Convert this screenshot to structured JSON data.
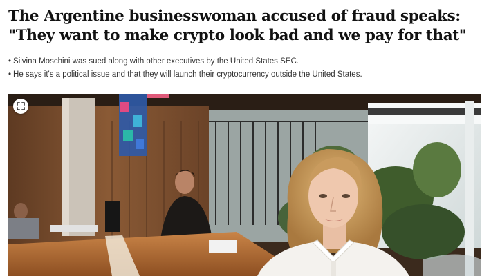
{
  "article": {
    "headline": "The Argentine businesswoman accused of fraud speaks: \"They want to make crypto look bad and we pay for that\"",
    "bullets": [
      "Silvina Moschini was sued along with other executives by the United States SEC.",
      "He says it's a political issue and that they will launch their cryptocurrency outside the United States."
    ]
  },
  "photo": {
    "expand_icon": "expand-icon",
    "colors": {
      "wood_wall": "#8a5a35",
      "table": "#b5703a",
      "window_light": "#e9eef0",
      "plants": "#4f6b3a",
      "blouse": "#f4f2ee",
      "hair": "#c89a5a"
    }
  }
}
